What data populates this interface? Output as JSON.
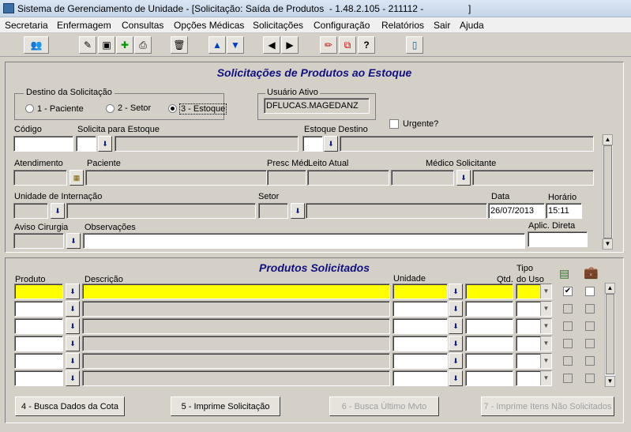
{
  "window": {
    "title": "Sistema de Gerenciamento de Unidade - [Solicitação: Saída de Produtos  - 1.48.2.105 - 211112 -                 ]"
  },
  "menu": [
    "Secretaria",
    "Enfermagem",
    "Consultas",
    "Opções Médicas",
    "Solicitações",
    "Configuração",
    "Relatórios",
    "Sair",
    "Ajuda"
  ],
  "toolbar": {
    "icons": [
      "users-icon",
      "edit-icon",
      "save-icon",
      "add-icon",
      "print-icon",
      "trash-icon",
      "arrow-up-icon",
      "arrow-down-icon",
      "first-record-icon",
      "last-record-icon",
      "pencil-icon",
      "copy-icon",
      "help-icon",
      "exit-door-icon"
    ]
  },
  "header": {
    "title": "Solicitações de Produtos ao Estoque",
    "destino": {
      "label": "Destino da Solicitação",
      "options": [
        "1 - Paciente",
        "2 - Setor",
        "3 - Estoque"
      ],
      "selected": "3 - Estoque"
    },
    "usuario": {
      "label": "Usuário Ativo",
      "value": "DFLUCAS.MAGEDANZ"
    },
    "urgente": {
      "label": "Urgente?",
      "checked": false
    },
    "codigo": {
      "label": "Código",
      "value": ""
    },
    "solicita": {
      "label": "Solicita para Estoque",
      "value": ""
    },
    "estoque_destino": {
      "label": "Estoque Destino",
      "value": ""
    },
    "atendimento": {
      "label": "Atendimento",
      "value": ""
    },
    "paciente": {
      "label": "Paciente",
      "value": ""
    },
    "presc": {
      "label": "Presc Méd",
      "value": ""
    },
    "leito": {
      "label": "Leito Atual",
      "value": ""
    },
    "medico": {
      "label": "Médico Solicitante",
      "value": ""
    },
    "unidade": {
      "label": "Unidade de Internação",
      "value": ""
    },
    "setor": {
      "label": "Setor",
      "value": ""
    },
    "data": {
      "label": "Data",
      "value": "26/07/2013"
    },
    "horario": {
      "label": "Horário",
      "value": "15:11"
    },
    "aviso": {
      "label": "Aviso Cirurgia",
      "value": ""
    },
    "observacoes": {
      "label": "Observações",
      "value": ""
    },
    "aplic": {
      "label": "Aplic. Direta",
      "value": ""
    }
  },
  "products": {
    "title": "Produtos Solicitados",
    "columns": {
      "produto": "Produto",
      "descricao": "Descrição",
      "unidade": "Unidade",
      "qtd": "Qtd.",
      "tipo1": "Tipo",
      "tipo2": "do Uso"
    },
    "col_icons": [
      "money-note-icon",
      "briefcase-icon"
    ],
    "rows": [
      {
        "produto": "",
        "descricao": "",
        "unidade": "",
        "qtd": "",
        "tipo": "",
        "check1": true,
        "check2": false
      },
      {
        "produto": "",
        "descricao": "",
        "unidade": "",
        "qtd": "",
        "tipo": "",
        "check1": false,
        "check2": false
      },
      {
        "produto": "",
        "descricao": "",
        "unidade": "",
        "qtd": "",
        "tipo": "",
        "check1": false,
        "check2": false
      },
      {
        "produto": "",
        "descricao": "",
        "unidade": "",
        "qtd": "",
        "tipo": "",
        "check1": false,
        "check2": false
      },
      {
        "produto": "",
        "descricao": "",
        "unidade": "",
        "qtd": "",
        "tipo": "",
        "check1": false,
        "check2": false
      },
      {
        "produto": "",
        "descricao": "",
        "unidade": "",
        "qtd": "",
        "tipo": "",
        "check1": false,
        "check2": false
      }
    ]
  },
  "buttons": {
    "busca_cota": "4 - Busca Dados da Cota",
    "imprime": "5 - Imprime Solicitação",
    "ultimo": "6 - Busca Último Mvto",
    "nao_solic": "7 - Imprime Itens Não Solicitados"
  }
}
